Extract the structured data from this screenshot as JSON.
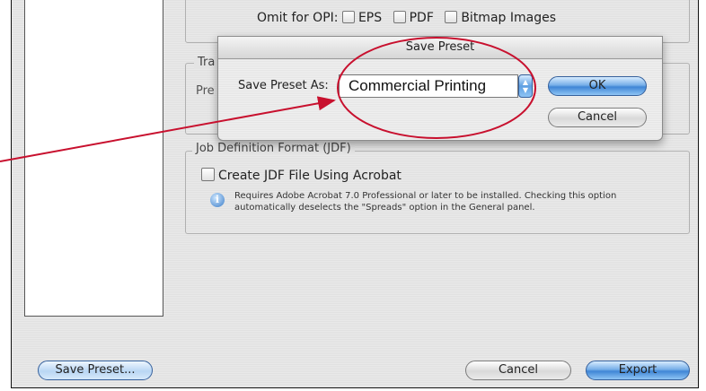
{
  "omit_for_opi": {
    "label": "Omit for OPI:",
    "options": [
      "EPS",
      "PDF",
      "Bitmap Images"
    ]
  },
  "hidden_group": {
    "label_partial": "Tra",
    "row_label_partial": "Pre"
  },
  "jdf_group": {
    "label": "Job Definition Format (JDF)",
    "checkbox_label": "Create JDF File Using Acrobat",
    "note_line1": "Requires Adobe Acrobat 7.0 Professional or later to be installed. Checking this option",
    "note_line2": "automatically deselects the \"Spreads\" option in the General panel."
  },
  "save_preset_sheet": {
    "title": "Save Preset",
    "field_label": "Save Preset As:",
    "field_value": "Commercial Printing",
    "ok_label": "OK",
    "cancel_label": "Cancel"
  },
  "footer": {
    "save_preset_label": "Save Preset...",
    "cancel_label": "Cancel",
    "export_label": "Export"
  },
  "colors": {
    "annotation_red": "#c8102e",
    "aqua_blue": "#3f86d6"
  },
  "icons": [
    "info-icon",
    "stepper-arrows-icon"
  ]
}
